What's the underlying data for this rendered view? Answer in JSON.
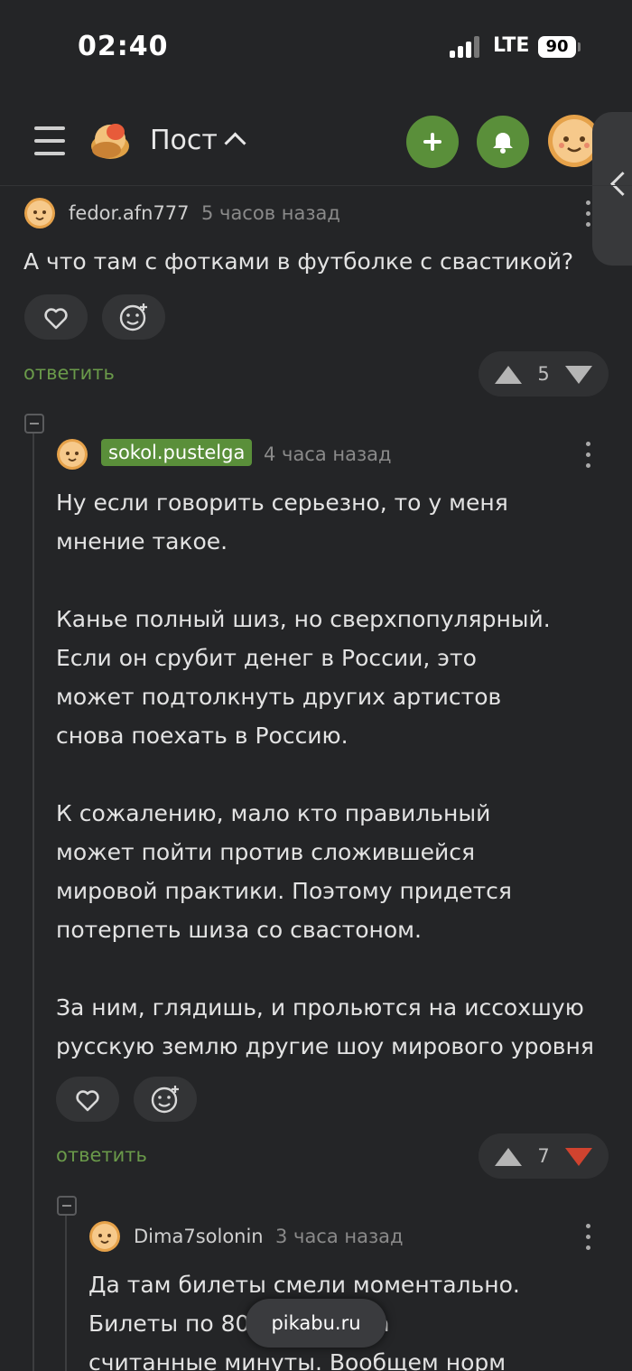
{
  "status_bar": {
    "time": "02:40",
    "network": "LTE",
    "battery": "90"
  },
  "header": {
    "title": "Пост"
  },
  "colors": {
    "accent": "#5a8f3a",
    "downvote_active": "#d0432f",
    "background": "#242527"
  },
  "icons": {
    "menu": "hamburger-icon",
    "add": "plus-icon",
    "bell": "bell-icon",
    "like": "heart-icon",
    "react": "smiley-plus-icon"
  },
  "comments": [
    {
      "author": "fedor.afn777",
      "time": "5 часов назад",
      "text": "А что там с фотками в футболке с свастикой?",
      "reply": "ответить",
      "rating": "5",
      "downvoted": false
    },
    {
      "author": "sokol.pustelga",
      "author_badge": true,
      "time": "4 часа назад",
      "text": "Ну если говорить серьезно, то у меня\nмнение такое.\n\nКанье полный шиз, но сверхпопулярный.\nЕсли он срубит денег в России, это\nможет подтолкнуть других артистов\nснова поехать в Россию.\n\nК сожалению, мало кто правильный\nможет пойти против сложившейся\nмировой практики. Поэтому придется\nпотерпеть шиза со свастоном.\n\nЗа ним, глядишь, и прольются на иссохшую\nрусскую землю другие шоу мирового уровня",
      "reply": "ответить",
      "rating": "7",
      "downvoted": true
    },
    {
      "author": "Dima7solonin",
      "time": "3 часа назад",
      "text": "Да там билеты смели моментально.\nБилеты по 80… …лись за\nсчитанные минуты. Вообщем норм"
    }
  ],
  "watermark": "pikabu.ru"
}
